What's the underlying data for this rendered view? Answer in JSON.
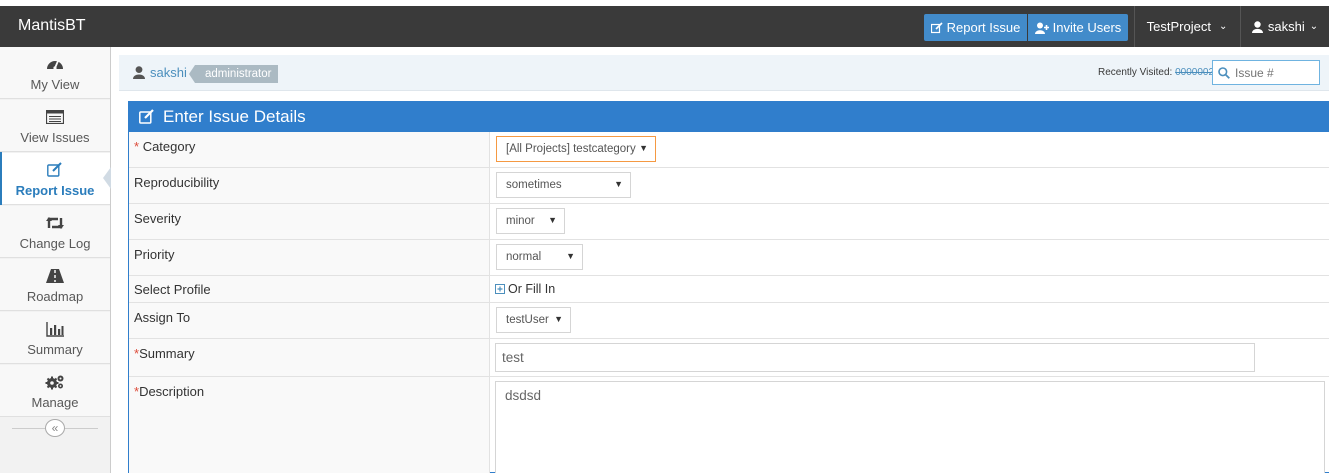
{
  "navbar": {
    "brand": "MantisBT",
    "report_issue": "Report Issue",
    "invite_users": "Invite Users",
    "project": "TestProject",
    "user": "sakshi"
  },
  "sidebar": {
    "items": [
      {
        "label": "My View",
        "icon": "dashboard-icon"
      },
      {
        "label": "View Issues",
        "icon": "list-icon"
      },
      {
        "label": "Report Issue",
        "icon": "edit-icon",
        "active": true
      },
      {
        "label": "Change Log",
        "icon": "retweet-icon"
      },
      {
        "label": "Roadmap",
        "icon": "road-icon"
      },
      {
        "label": "Summary",
        "icon": "bar-chart-icon"
      },
      {
        "label": "Manage",
        "icon": "gears-icon"
      }
    ],
    "collapse_glyph": "«"
  },
  "breadcrumb": {
    "user": "sakshi",
    "role": "administrator",
    "recently_visited_label": "Recently Visited:",
    "recently_visited_link": "0000002",
    "search_placeholder": "Issue #"
  },
  "form": {
    "title": "Enter Issue Details",
    "required_mark": "*",
    "category_label": "Category",
    "category_value": "[All Projects] testcategory",
    "reproducibility_label": "Reproducibility",
    "reproducibility_value": "sometimes",
    "severity_label": "Severity",
    "severity_value": "minor",
    "priority_label": "Priority",
    "priority_value": "normal",
    "profile_label": "Select Profile",
    "profile_fill_in": "Or Fill In",
    "assign_label": "Assign To",
    "assign_value": "testUser",
    "summary_label": "Summary",
    "summary_value": "test",
    "description_label": "Description",
    "description_value": "dsdsd"
  },
  "colors": {
    "navbar": "#3a3a3a",
    "primary": "#428bca",
    "header": "#307ecc",
    "active": "#2b7dbc",
    "required": "#dd4b39"
  }
}
